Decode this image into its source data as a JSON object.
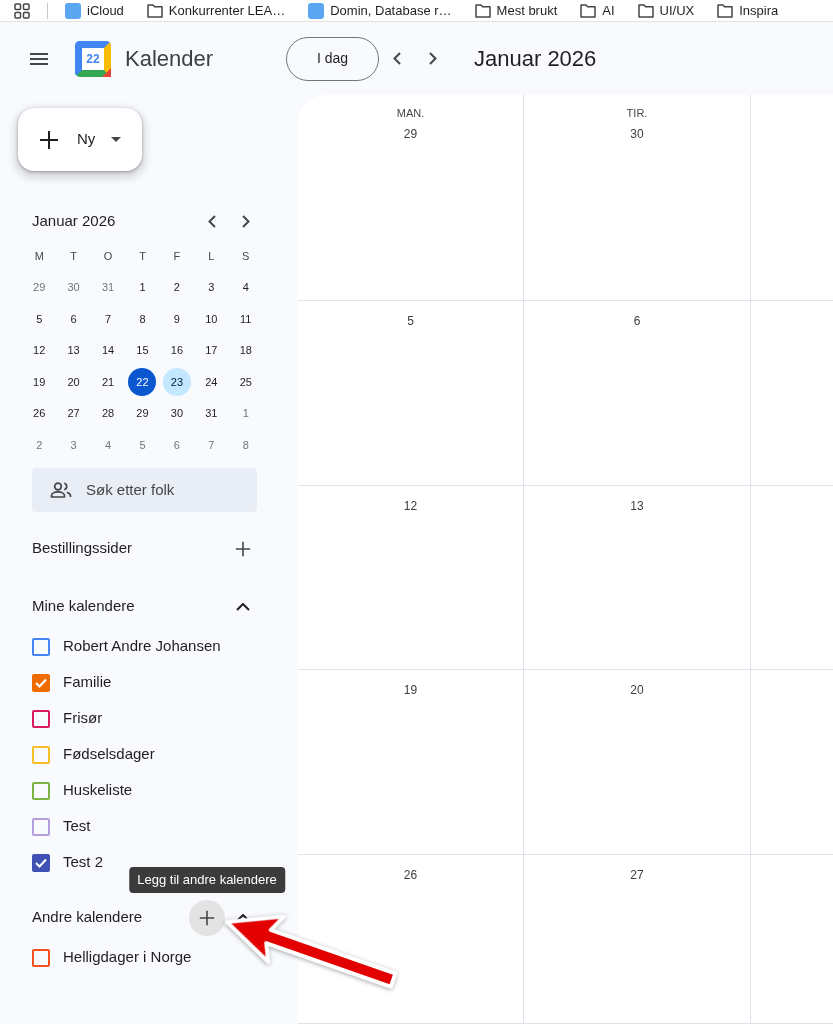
{
  "bookmarks_bar": {
    "items": [
      {
        "label": "iCloud",
        "kind": "site"
      },
      {
        "label": "Konkurrenter LEA…",
        "kind": "folder"
      },
      {
        "label": "Domin, Database r…",
        "kind": "site"
      },
      {
        "label": "Mest brukt",
        "kind": "folder"
      },
      {
        "label": "AI",
        "kind": "folder"
      },
      {
        "label": "UI/UX",
        "kind": "folder"
      },
      {
        "label": "Inspira",
        "kind": "folder"
      }
    ]
  },
  "header": {
    "logo_date": "22",
    "app_name": "Kalender",
    "today_button": "I dag",
    "period": "Januar 2026"
  },
  "sidebar": {
    "create_button": "Ny",
    "mini_calendar": {
      "title": "Januar 2026",
      "weekdays": [
        "M",
        "T",
        "O",
        "T",
        "F",
        "L",
        "S"
      ],
      "weeks": [
        [
          {
            "label": "29",
            "outside_month": true,
            "today": false,
            "selected": false
          },
          {
            "label": "30",
            "outside_month": true,
            "today": false,
            "selected": false
          },
          {
            "label": "31",
            "outside_month": true,
            "today": false,
            "selected": false
          },
          {
            "label": "1",
            "outside_month": false,
            "today": false,
            "selected": false
          },
          {
            "label": "2",
            "outside_month": false,
            "today": false,
            "selected": false
          },
          {
            "label": "3",
            "outside_month": false,
            "today": false,
            "selected": false
          },
          {
            "label": "4",
            "outside_month": false,
            "today": false,
            "selected": false
          }
        ],
        [
          {
            "label": "5",
            "outside_month": false,
            "today": false,
            "selected": false
          },
          {
            "label": "6",
            "outside_month": false,
            "today": false,
            "selected": false
          },
          {
            "label": "7",
            "outside_month": false,
            "today": false,
            "selected": false
          },
          {
            "label": "8",
            "outside_month": false,
            "today": false,
            "selected": false
          },
          {
            "label": "9",
            "outside_month": false,
            "today": false,
            "selected": false
          },
          {
            "label": "10",
            "outside_month": false,
            "today": false,
            "selected": false
          },
          {
            "label": "11",
            "outside_month": false,
            "today": false,
            "selected": false
          }
        ],
        [
          {
            "label": "12",
            "outside_month": false,
            "today": false,
            "selected": false
          },
          {
            "label": "13",
            "outside_month": false,
            "today": false,
            "selected": false
          },
          {
            "label": "14",
            "outside_month": false,
            "today": false,
            "selected": false
          },
          {
            "label": "15",
            "outside_month": false,
            "today": false,
            "selected": false
          },
          {
            "label": "16",
            "outside_month": false,
            "today": false,
            "selected": false
          },
          {
            "label": "17",
            "outside_month": false,
            "today": false,
            "selected": false
          },
          {
            "label": "18",
            "outside_month": false,
            "today": false,
            "selected": false
          }
        ],
        [
          {
            "label": "19",
            "outside_month": false,
            "today": false,
            "selected": false
          },
          {
            "label": "20",
            "outside_month": false,
            "today": false,
            "selected": false
          },
          {
            "label": "21",
            "outside_month": false,
            "today": false,
            "selected": false
          },
          {
            "label": "22",
            "outside_month": false,
            "today": true,
            "selected": false
          },
          {
            "label": "23",
            "outside_month": false,
            "today": false,
            "selected": true
          },
          {
            "label": "24",
            "outside_month": false,
            "today": false,
            "selected": false
          },
          {
            "label": "25",
            "outside_month": false,
            "today": false,
            "selected": false
          }
        ],
        [
          {
            "label": "26",
            "outside_month": false,
            "today": false,
            "selected": false
          },
          {
            "label": "27",
            "outside_month": false,
            "today": false,
            "selected": false
          },
          {
            "label": "28",
            "outside_month": false,
            "today": false,
            "selected": false
          },
          {
            "label": "29",
            "outside_month": false,
            "today": false,
            "selected": false
          },
          {
            "label": "30",
            "outside_month": false,
            "today": false,
            "selected": false
          },
          {
            "label": "31",
            "outside_month": false,
            "today": false,
            "selected": false
          },
          {
            "label": "1",
            "outside_month": true,
            "today": false,
            "selected": false
          }
        ],
        [
          {
            "label": "2",
            "outside_month": true,
            "today": false,
            "selected": false
          },
          {
            "label": "3",
            "outside_month": true,
            "today": false,
            "selected": false
          },
          {
            "label": "4",
            "outside_month": true,
            "today": false,
            "selected": false
          },
          {
            "label": "5",
            "outside_month": true,
            "today": false,
            "selected": false
          },
          {
            "label": "6",
            "outside_month": true,
            "today": false,
            "selected": false
          },
          {
            "label": "7",
            "outside_month": true,
            "today": false,
            "selected": false
          },
          {
            "label": "8",
            "outside_month": true,
            "today": false,
            "selected": false
          }
        ]
      ]
    },
    "people_search": {
      "placeholder": "Søk etter folk"
    },
    "booking_pages": {
      "title": "Bestillingssider"
    },
    "my_calendars": {
      "title": "Mine kalendere",
      "expanded": true,
      "items": [
        {
          "name": "Robert Andre Johansen",
          "color": "#4285f4",
          "checked": false
        },
        {
          "name": "Familie",
          "color": "#ef6c00",
          "checked": true
        },
        {
          "name": "Frisør",
          "color": "#d81b60",
          "checked": false
        },
        {
          "name": "Fødselsdager",
          "color": "#f6bf26",
          "checked": false
        },
        {
          "name": "Huskeliste",
          "color": "#7cb342",
          "checked": false
        },
        {
          "name": "Test",
          "color": "#b39ddb",
          "checked": false
        },
        {
          "name": "Test 2",
          "color": "#3f51b5",
          "checked": true
        }
      ]
    },
    "other_calendars": {
      "title": "Andre kalendere",
      "expanded": true,
      "add_hovered": true,
      "tooltip": "Legg til andre kalendere",
      "items": [
        {
          "name": "Helligdager i Norge",
          "color": "#f4511e",
          "checked": false
        }
      ]
    }
  },
  "month_view": {
    "columns": [
      {
        "weekday": "MAN."
      },
      {
        "weekday": "TIR."
      }
    ],
    "weeks": [
      [
        "29",
        "30"
      ],
      [
        "5",
        "6"
      ],
      [
        "12",
        "13"
      ],
      [
        "19",
        "20"
      ],
      [
        "26",
        "27"
      ]
    ]
  },
  "annotations": [
    {
      "kind": "arrow"
    }
  ]
}
